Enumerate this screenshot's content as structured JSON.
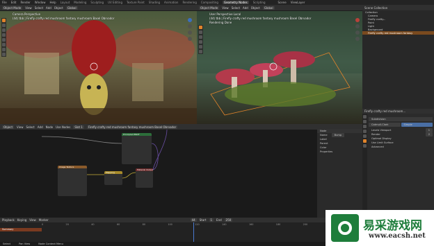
{
  "menubar": {
    "items": [
      "File",
      "Edit",
      "Render",
      "Window",
      "Help"
    ],
    "workspaces": [
      "Layout",
      "Modeling",
      "Sculpting",
      "UV Editing",
      "Texture Paint",
      "Shading",
      "Animation",
      "Rendering",
      "Compositing",
      "Geometry Nodes",
      "Scripting"
    ],
    "active_workspace": "Geometry Nodes",
    "scene_label": "Scene",
    "view_layer_label": "ViewLayer"
  },
  "left_viewport": {
    "mode": "Object Mode",
    "menus": [
      "View",
      "Select",
      "Add",
      "Object"
    ],
    "orientation": "Global",
    "camera_label": "Camera Perspective",
    "object_info": "(44) tbb | Firefly crafty red mushroom fantasy mushroom Basel Obrvador"
  },
  "right_viewport": {
    "mode": "Object Mode",
    "menus": [
      "View",
      "Select",
      "Add",
      "Object"
    ],
    "orientation": "Global",
    "view_label": "User Perspective Local",
    "object_info": "(44) tbb | Firefly crafty red mushroom fantasy mushroom Basel Obrvador",
    "status": "Rendering Done"
  },
  "outliner": {
    "title": "Scene Collection",
    "rows": [
      "Collection",
      "Camera",
      "Firefly crafty...",
      "Point",
      "Light",
      "Background",
      "Firefly crafty red mushroom fantasy"
    ]
  },
  "node_editor": {
    "menus": [
      "Object",
      "View",
      "Select",
      "Add",
      "Node",
      "Use Nodes"
    ],
    "slot": "Slot 1",
    "material": "Firefly crafty red mushroom fantasy mushroom Basel Obrvador",
    "nodes": [
      "Image Texture",
      "Mapping",
      "Principled BSDF",
      "Material Output"
    ]
  },
  "side_panel": {
    "title": "Node",
    "name_label": "Name",
    "label_label": "Label",
    "name_value": "Bump",
    "parent_label": "Parent",
    "color_label": "Color",
    "properties_label": "Properties"
  },
  "properties": {
    "object_name": "Firefly crafty red mushroom...",
    "modifier": "Subdivision",
    "tabs": [
      "Catmull-Clark",
      "Simple"
    ],
    "levels_label": "Levels Viewport",
    "levels_value": "1",
    "render_label": "Render",
    "render_value": "2",
    "optimal_display": "Optimal Display",
    "advanced": "Advanced",
    "gpu_label": "Use Limit Surface"
  },
  "timeline": {
    "menus": [
      "Playback",
      "Keying",
      "View",
      "Marker"
    ],
    "start_label": "Start",
    "start_value": "1",
    "end_label": "End",
    "end_value": "250",
    "current_frame": "44",
    "ticks": [
      "0",
      "20",
      "40",
      "60",
      "80",
      "100",
      "120",
      "140",
      "160",
      "180",
      "200",
      "220",
      "240"
    ],
    "keyframe_label": "Summary"
  },
  "statusbar": {
    "items": [
      "Select",
      "Pan View",
      "Node Context Menu"
    ]
  },
  "watermark": {
    "brand": "易采游戏网",
    "url": "www.eacsh.net"
  },
  "colors": {
    "accent": "#e0832a",
    "selection": "#7a4a1e",
    "panel": "#2b2b2b",
    "background": "#1d1d1d"
  }
}
